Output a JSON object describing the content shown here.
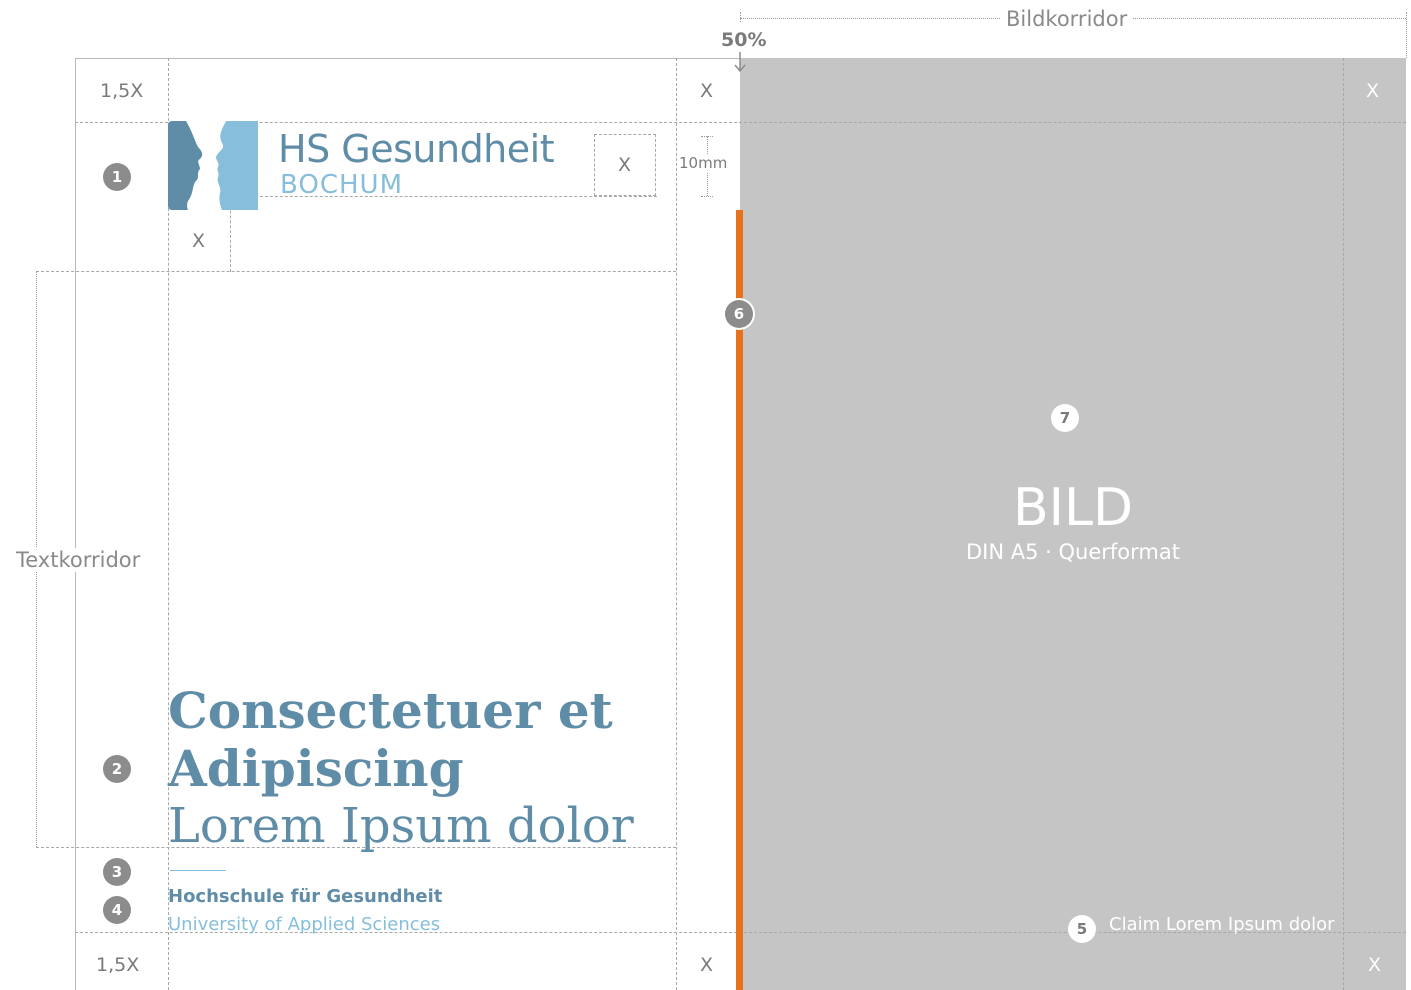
{
  "header": {
    "bildkorridor_label": "Bildkorridor",
    "midpoint_label": "50%"
  },
  "margins": {
    "top_left": "1,5X",
    "top_middle": "X",
    "top_right": "X",
    "logo_right": "X",
    "logo_below": "X",
    "logo_gap": "10mm",
    "bottom_left": "1,5X",
    "bottom_middle": "X",
    "bottom_right": "X"
  },
  "textkorridor_label": "Textkorridor",
  "logo": {
    "name": "HS Gesundheit",
    "city": "BOCHUM"
  },
  "headline": {
    "line1": "Consectetuer et",
    "line2": "Adipiscing",
    "line3": "Lorem Ipsum dolor"
  },
  "footer": {
    "institution": "Hochschule für Gesundheit",
    "subtitle": "University of Applied Sciences"
  },
  "image_area": {
    "title": "BILD",
    "subtitle": "DIN A5 · Querformat",
    "claim": "Claim Lorem Ipsum dolor"
  },
  "markers": [
    "1",
    "2",
    "3",
    "4",
    "5",
    "6",
    "7"
  ],
  "colors": {
    "brand_blue": "#5f8ca6",
    "light_blue": "#86bedc",
    "accent_orange": "#e8711c",
    "image_gray": "#c4c5c4"
  }
}
